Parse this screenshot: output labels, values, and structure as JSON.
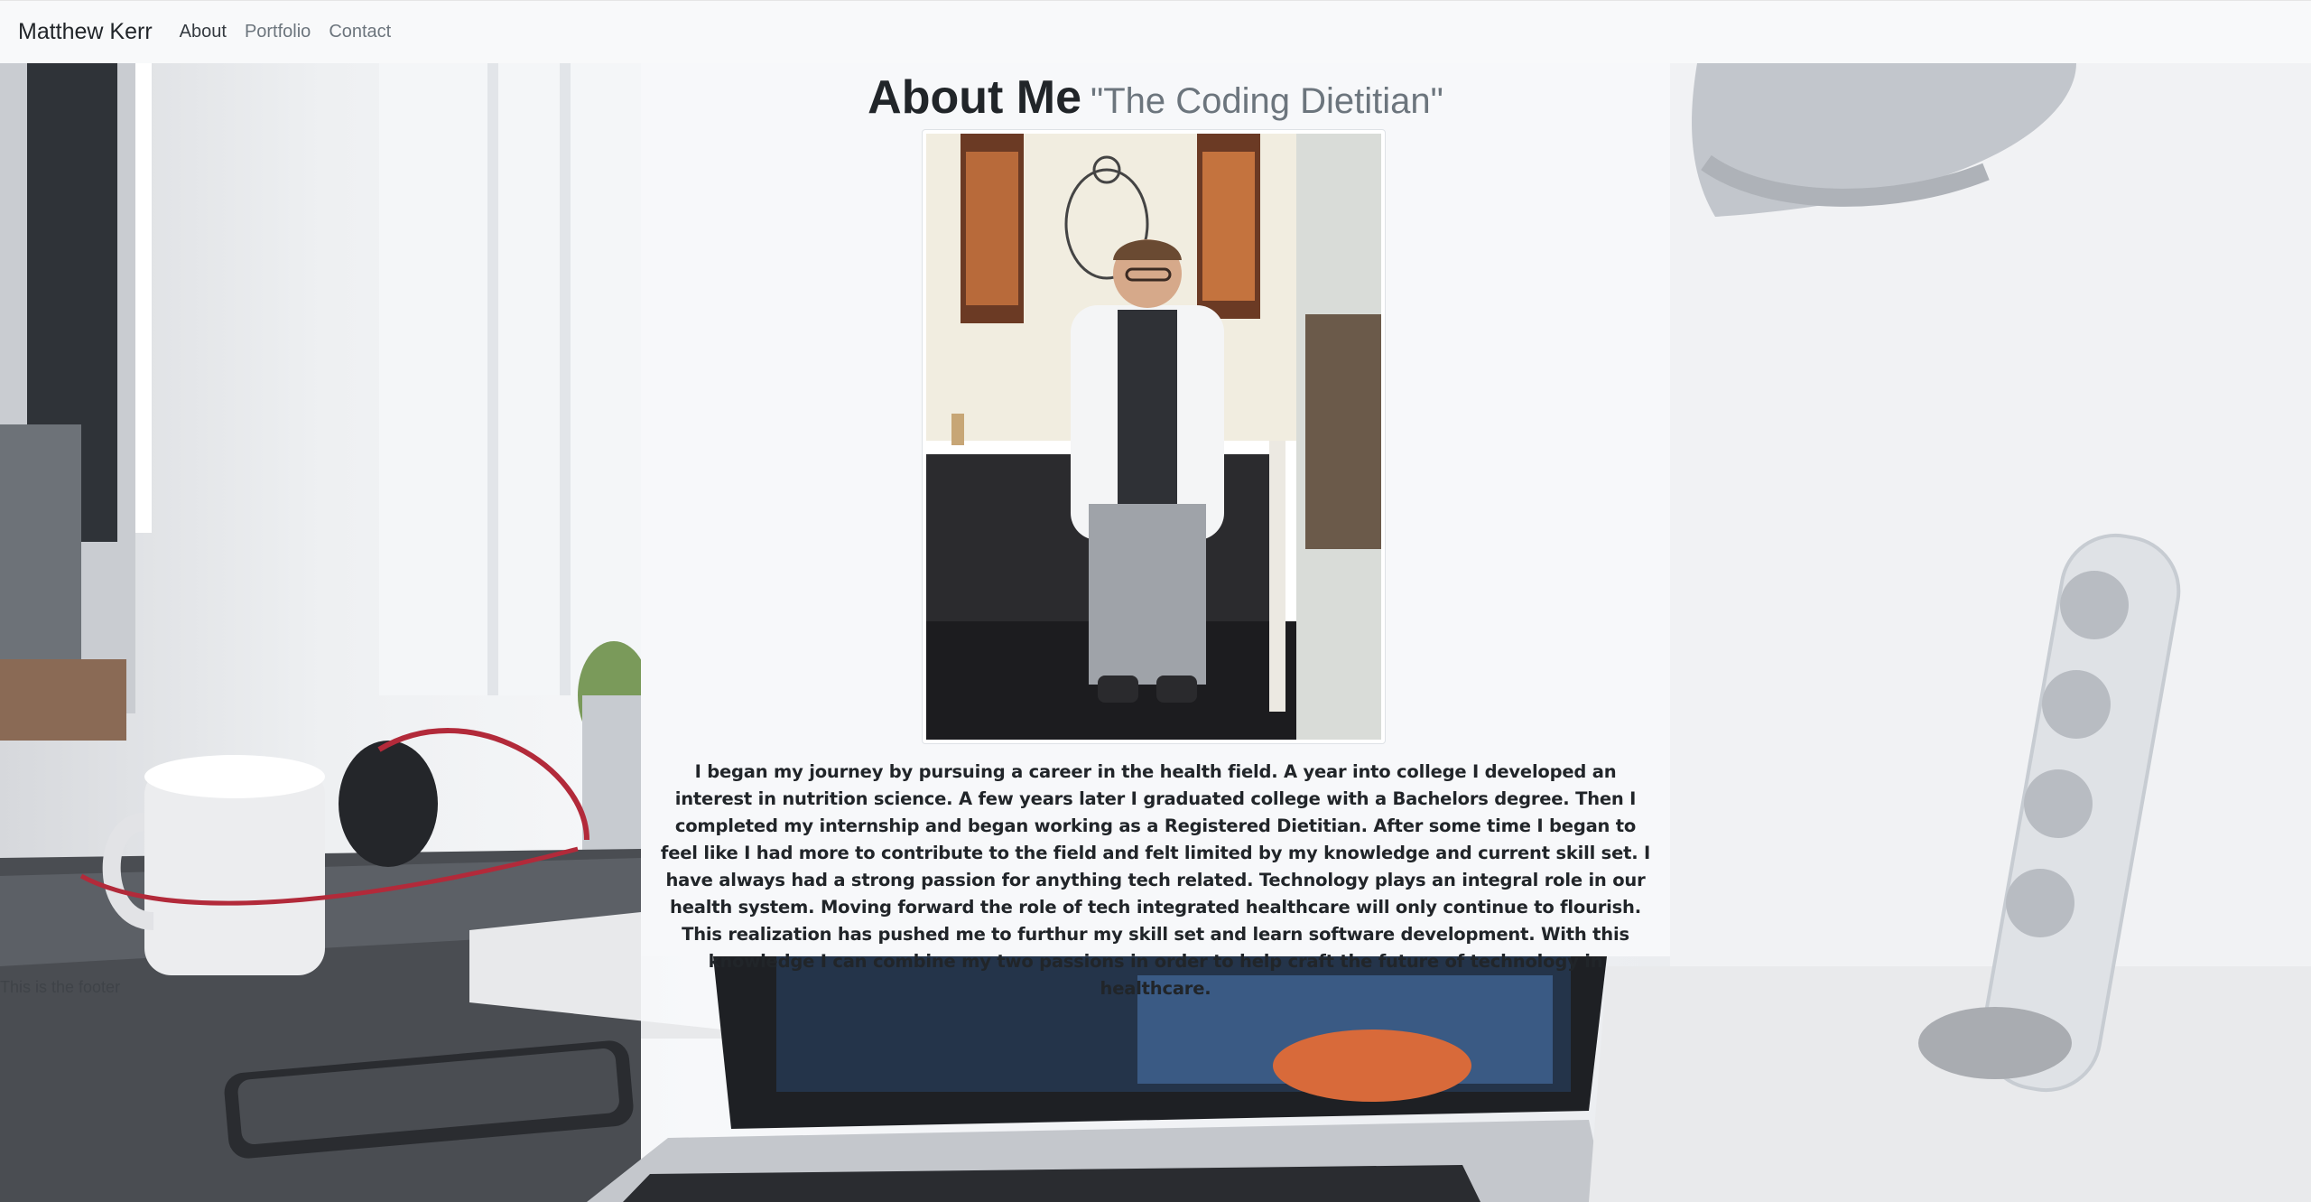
{
  "navbar": {
    "brand": "Matthew Kerr",
    "links": [
      {
        "label": "About",
        "active": true
      },
      {
        "label": "Portfolio",
        "active": false
      },
      {
        "label": "Contact",
        "active": false
      }
    ]
  },
  "about": {
    "title": "About Me",
    "subtitle": "\"The Coding Dietitian\"",
    "bio": "I began my journey by pursuing a career in the health field. A year into college I developed an interest in nutrition science. A few years later I graduated college with a Bachelors degree. Then I completed my internship and began working as a Registered Dietitian. After some time I began to feel like I had more to contribute to the field and felt limited by my knowledge and current skill set. I have always had a strong passion for anything tech related. Technology plays an integral role in our health system. Moving forward the role of tech integrated healthcare will only continue to flourish. This realization has pushed me to furthur my skill set and learn software development. With this knowledge I can combine my two passions in order to help craft the future of technology in healthcare."
  },
  "footer": {
    "text": "This is the footer"
  },
  "colors": {
    "navbar_bg": "#f8f9fa",
    "panel_bg": "#f7f8fa",
    "text_dark": "#212529",
    "text_muted": "#6c757d"
  }
}
